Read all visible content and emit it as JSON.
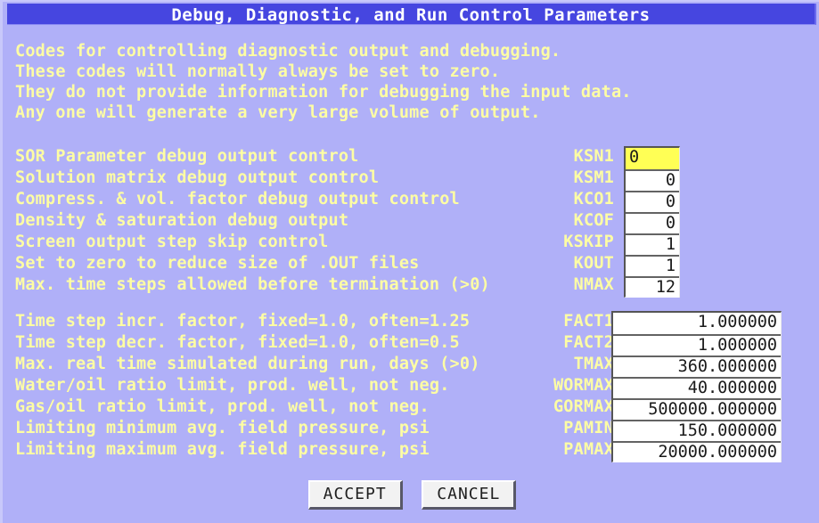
{
  "window": {
    "title": "Debug, Diagnostic, and Run Control Parameters"
  },
  "intro": {
    "lines": [
      "Codes for controlling diagnostic output and debugging.",
      "These codes will normally always be set to zero.",
      "They do not provide information for debugging the input data.",
      "Any one will generate a very large volume of output."
    ]
  },
  "group1": {
    "rows": [
      {
        "description": "SOR Parameter debug output control",
        "code": "KSN1",
        "value": "0",
        "focused": true
      },
      {
        "description": "Solution matrix debug output control",
        "code": "KSM1",
        "value": "0",
        "focused": false
      },
      {
        "description": "Compress. & vol. factor debug output control",
        "code": "KCO1",
        "value": "0",
        "focused": false
      },
      {
        "description": "Density & saturation debug output",
        "code": "KCOF",
        "value": "0",
        "focused": false
      },
      {
        "description": "Screen output step skip control",
        "code": "KSKIP",
        "value": "1",
        "focused": false
      },
      {
        "description": "Set to zero to reduce size of .OUT files",
        "code": "KOUT",
        "value": "1",
        "focused": false
      },
      {
        "description": "Max. time steps allowed before termination (>0)",
        "code": "NMAX",
        "value": "12",
        "focused": false
      }
    ]
  },
  "group2": {
    "rows": [
      {
        "description": "Time step incr. factor, fixed=1.0, often=1.25",
        "code": "FACT1",
        "value": "1.000000",
        "focused": false
      },
      {
        "description": "Time step decr. factor, fixed=1.0, often=0.5",
        "code": "FACT2",
        "value": "1.000000",
        "focused": false
      },
      {
        "description": "Max. real time simulated during run, days (>0)",
        "code": "TMAX",
        "value": "360.000000",
        "focused": false
      },
      {
        "description": "Water/oil ratio limit, prod. well, not neg.",
        "code": "WORMAX",
        "value": "40.000000",
        "focused": false
      },
      {
        "description": "Gas/oil ratio limit, prod. well, not neg.",
        "code": "GORMAX",
        "value": "500000.000000",
        "focused": false
      },
      {
        "description": "Limiting minimum avg. field pressure, psi",
        "code": "PAMIN",
        "value": "150.000000",
        "focused": false
      },
      {
        "description": "Limiting maximum avg. field pressure, psi",
        "code": "PAMAX",
        "value": "20000.000000",
        "focused": false
      }
    ]
  },
  "buttons": {
    "accept": "ACCEPT",
    "cancel": "CANCEL"
  },
  "colors": {
    "window_background": "#b0b0f8",
    "titlebar": "#4646e0",
    "label_text": "#fdfda4",
    "field_background": "#ffffff",
    "field_focused_background": "#ffff55",
    "button_face": "#f2f2f2"
  }
}
